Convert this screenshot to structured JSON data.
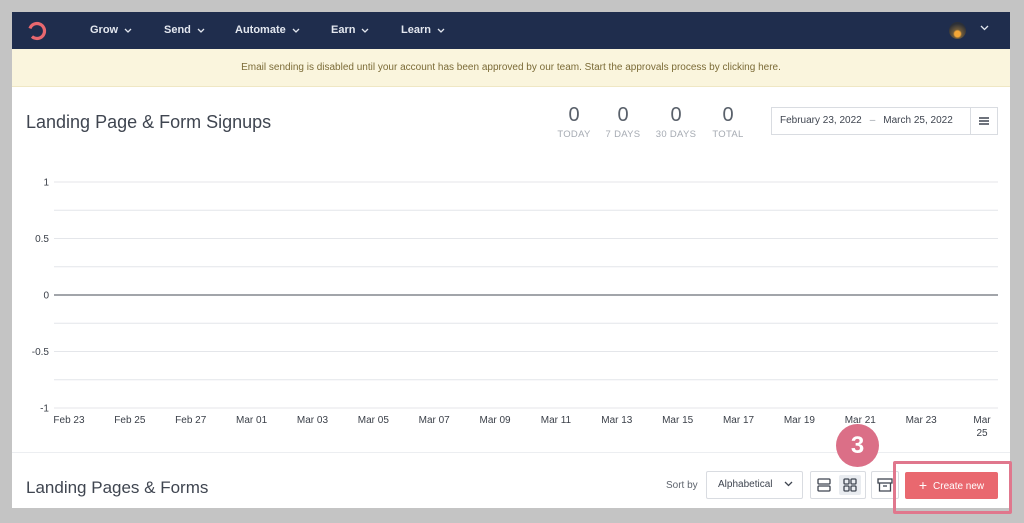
{
  "nav": {
    "items": [
      {
        "label": "Grow"
      },
      {
        "label": "Send"
      },
      {
        "label": "Automate"
      },
      {
        "label": "Earn"
      },
      {
        "label": "Learn"
      }
    ],
    "brand_color": "#1f2d4d",
    "logo_color": "#e9686f"
  },
  "banner": {
    "text": "Email sending is disabled until your account has been approved by our team. Start the approvals process by clicking here."
  },
  "signups": {
    "title": "Landing Page & Form Signups",
    "stats": [
      {
        "value": "0",
        "label": "TODAY"
      },
      {
        "value": "0",
        "label": "7 DAYS"
      },
      {
        "value": "0",
        "label": "30 DAYS"
      },
      {
        "value": "0",
        "label": "TOTAL"
      }
    ],
    "date_range": {
      "start": "February 23, 2022",
      "separator": "–",
      "end": "March 25, 2022"
    }
  },
  "chart_data": {
    "type": "line",
    "x": [
      "Feb 23",
      "Feb 25",
      "Feb 27",
      "Mar 01",
      "Mar 03",
      "Mar 05",
      "Mar 07",
      "Mar 09",
      "Mar 11",
      "Mar 13",
      "Mar 15",
      "Mar 17",
      "Mar 19",
      "Mar 21",
      "Mar 23",
      "Mar 25"
    ],
    "series": [
      {
        "values": [
          0,
          0,
          0,
          0,
          0,
          0,
          0,
          0,
          0,
          0,
          0,
          0,
          0,
          0,
          0,
          0
        ]
      }
    ],
    "yticks": [
      "1",
      "0.5",
      "0",
      "-0.5",
      "-1"
    ],
    "ylim": [
      -1,
      1
    ],
    "grid": true
  },
  "forms": {
    "title": "Landing Pages & Forms",
    "sort_label": "Sort by",
    "sort_value": "Alphabetical",
    "create_label": "Create new",
    "step_number": "3",
    "accent_color": "#e9686f",
    "highlight_color": "#e0778d"
  }
}
